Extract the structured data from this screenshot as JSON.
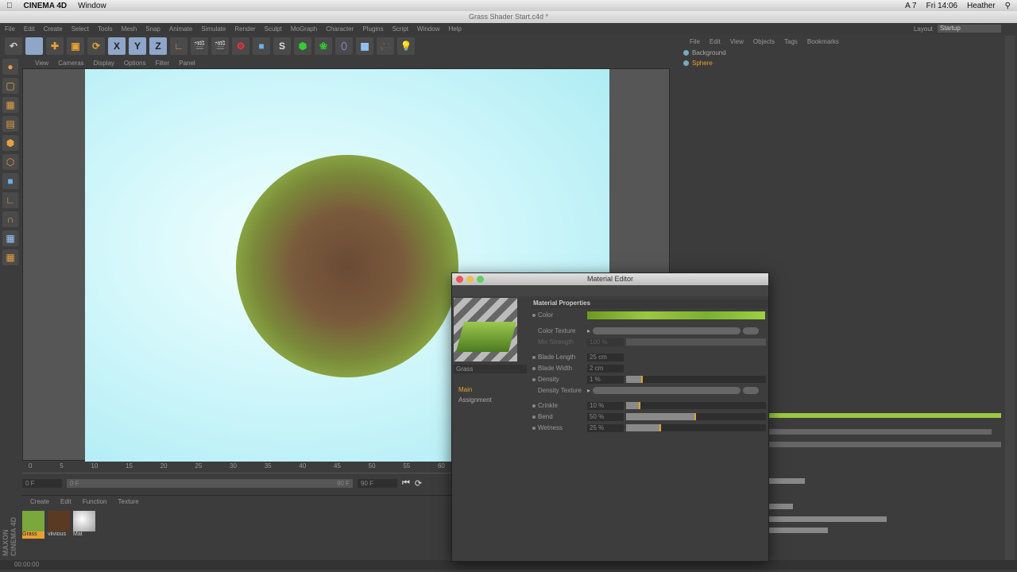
{
  "macbar": {
    "app": "CINEMA 4D",
    "menu": "Window",
    "status": [
      "A 7",
      "Fri 14:06",
      "Heather"
    ]
  },
  "window": {
    "title": "Grass Shader Start.c4d *"
  },
  "menu": [
    "File",
    "Edit",
    "Create",
    "Select",
    "Tools",
    "Mesh",
    "Snap",
    "Animate",
    "Simulate",
    "Render",
    "Sculpt",
    "MoGraph",
    "Character",
    "Plugins",
    "Script",
    "Window",
    "Help"
  ],
  "layout": {
    "label": "Layout",
    "value": "Startup"
  },
  "toolbar": {
    "axes": [
      "X",
      "Y",
      "Z"
    ]
  },
  "viewport": {
    "menu": [
      "View",
      "Cameras",
      "Display",
      "Options",
      "Filter",
      "Panel"
    ]
  },
  "timeline": {
    "ticks": [
      "0",
      "5",
      "10",
      "15",
      "20",
      "25",
      "30",
      "35",
      "40",
      "45",
      "50",
      "55",
      "60"
    ],
    "start": "0 F",
    "range_start": "0 F",
    "range_end": "90 F",
    "end": "90 F"
  },
  "material_manager": {
    "menu": [
      "Create",
      "Edit",
      "Function",
      "Texture"
    ],
    "materials": [
      {
        "name": "Grass",
        "color": "#7aa83c"
      },
      {
        "name": "vlivious",
        "color": "#5a3a22"
      },
      {
        "name": "Mat",
        "color": "#dddddd"
      }
    ]
  },
  "brand": "MAXON CINEMA 4D",
  "status": {
    "time": "00:00:00"
  },
  "object_manager": {
    "menu": [
      "File",
      "Edit",
      "View",
      "Objects",
      "Tags",
      "Bookmarks"
    ],
    "objects": [
      {
        "name": "Background"
      },
      {
        "name": "Sphere"
      }
    ]
  },
  "material_editor": {
    "title": "Material Editor",
    "material_name": "Grass",
    "nav": [
      "Main",
      "Assignment"
    ],
    "section": "Material Properties",
    "props": {
      "color": "Color",
      "color_texture": "Color Texture",
      "mix_strength": "Mix Strength",
      "mix_value": "100 %",
      "blade_length": "Blade Length",
      "blade_length_value": "25 cm",
      "blade_width": "Blade Width",
      "blade_width_value": "2 cm",
      "density": "Density",
      "density_value": "1 %",
      "density_texture": "Density Texture",
      "crinkle": "Crinkle",
      "crinkle_value": "10 %",
      "bend": "Bend",
      "bend_value": "50 %",
      "wetness": "Wetness",
      "wetness_value": "25 %"
    },
    "sliders": {
      "density": 0.12,
      "crinkle": 0.1,
      "bend": 0.5,
      "wetness": 0.25
    }
  }
}
